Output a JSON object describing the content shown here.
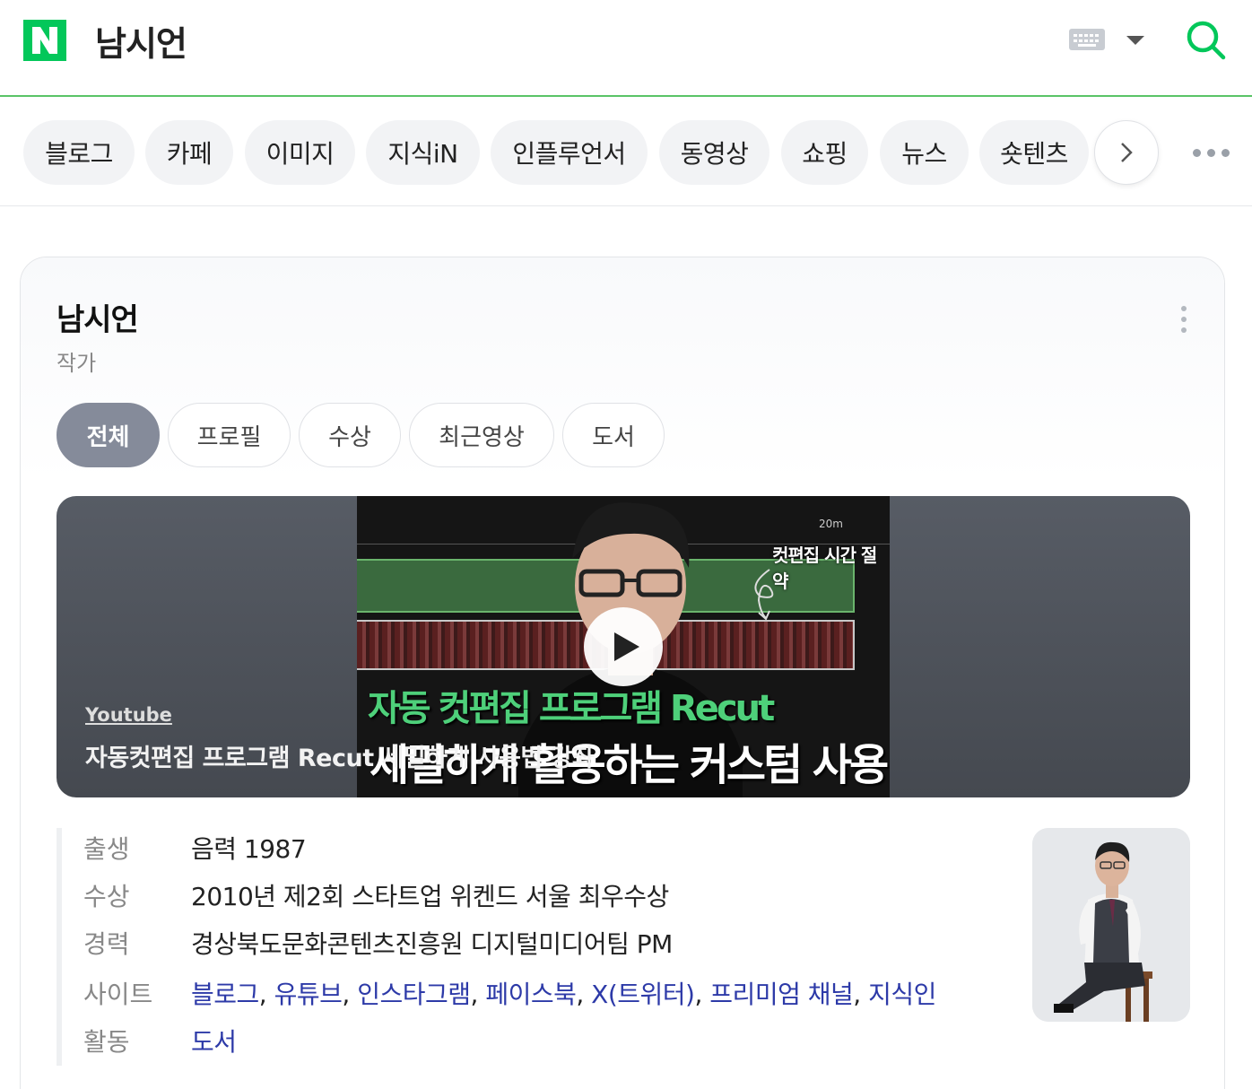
{
  "header": {
    "logo_letter": "N",
    "query": "남시언",
    "accent_color": "#03c75a"
  },
  "tabs": [
    "블로그",
    "카페",
    "이미지",
    "지식iN",
    "인플루언서",
    "동영상",
    "쇼핑",
    "뉴스",
    "숏텐츠"
  ],
  "profile": {
    "name": "남시언",
    "role": "작가"
  },
  "sub_tabs": [
    "전체",
    "프로필",
    "수상",
    "최근영상",
    "도서"
  ],
  "sub_tab_active": "전체",
  "video": {
    "source": "Youtube",
    "title": "자동컷편집 프로그램 Recut 세밀하게 사용법 강좌",
    "thumb_timestamp": "20m",
    "thumb_callout": "컷편집 시간 절약",
    "thumb_line1": "자동 컷편집 프로그램 Recut",
    "thumb_line2": "세밀하게 활용하는 커스텀 사용법"
  },
  "info": {
    "birth_label": "출생",
    "birth_value": "음력 1987",
    "award_label": "수상",
    "award_value": "2010년 제2회 스타트업 위켄드 서울 최우수상",
    "career_label": "경력",
    "career_value": "경상북도문화콘텐츠진흥원 디지털미디어팀 PM",
    "sites_label_1": "사이트",
    "sites_label_2": "활동",
    "sites": [
      "블로그",
      "유튜브",
      "인스타그램",
      "페이스북",
      "X(트위터)",
      "프리미엄 채널",
      "지식인",
      "도서"
    ],
    "sep": ", "
  }
}
